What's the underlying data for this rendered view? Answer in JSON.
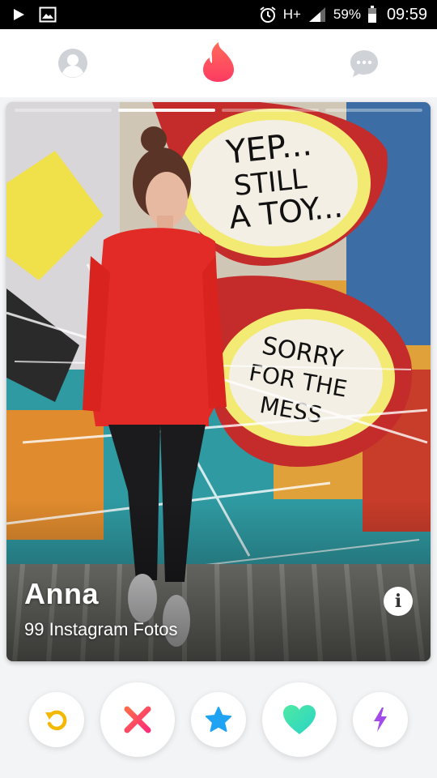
{
  "status_bar": {
    "network": "H+",
    "battery": "59%",
    "time": "09:59"
  },
  "nav": {
    "profile_icon": "profile-icon",
    "logo_icon": "tinder-flame-icon",
    "chat_icon": "chat-icon",
    "brand_color": "#fd5068"
  },
  "card": {
    "name": "Anna",
    "subtitle": "99 Instagram Fotos",
    "info_glyph": "i",
    "photo_count": 4,
    "active_photo": 1
  },
  "actions": [
    {
      "name": "rewind",
      "icon": "rewind-icon",
      "color": "#f5b800"
    },
    {
      "name": "nope",
      "icon": "close-icon",
      "color": "#fd4f66"
    },
    {
      "name": "super-like",
      "icon": "star-icon",
      "color": "#22a6f2"
    },
    {
      "name": "like",
      "icon": "heart-icon",
      "color": "#3ee3b9"
    },
    {
      "name": "boost",
      "icon": "lightning-icon",
      "color": "#a24be8"
    }
  ]
}
